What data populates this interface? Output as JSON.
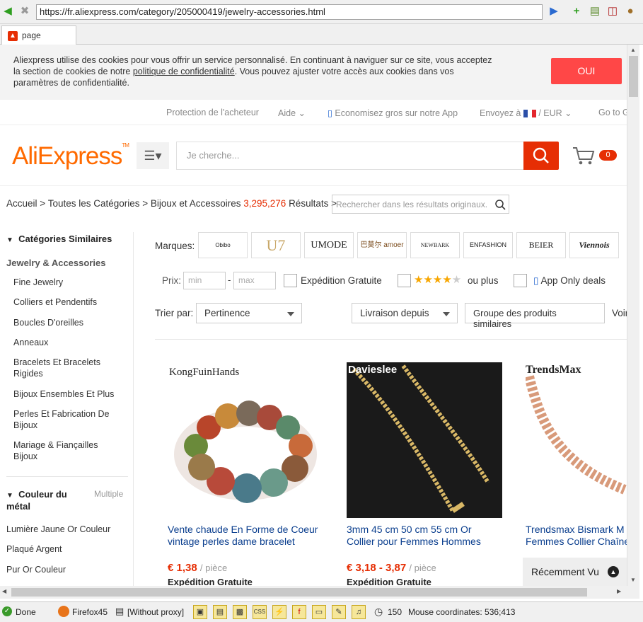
{
  "browser": {
    "url": "https://fr.aliexpress.com/category/205000419/jewelry-accessories.html",
    "tab_title": "page"
  },
  "cookie": {
    "text_1": "Aliexpress utilise des cookies pour vous offrir un service personnalisé. En continuant à naviguer sur ce site, vous acceptez la section de cookies de notre ",
    "link": "politique de confidentialité",
    "text_2": ". Vous pouvez ajuster votre accès aux cookies dans vos paramètres de confidentialité.",
    "ok": "OUI"
  },
  "topnav": {
    "protection": "Protection de l'acheteur",
    "aide": "Aide",
    "app": "Economisez gros sur notre App",
    "ship": "Envoyez à",
    "currency": "EUR",
    "goto": "Go to G"
  },
  "header": {
    "logo": "AliExpress",
    "search_placeholder": "Je cherche...",
    "cart_count": "0"
  },
  "breadcrumb": {
    "home": "Accueil",
    "all": "Toutes les Catégories",
    "current": "Bijoux et Accessoires",
    "count": "3,295,276",
    "results": "Résultats",
    "refine_placeholder": "Rechercher dans les résultats originaux."
  },
  "sidebar": {
    "similar_title": "Catégories Similaires",
    "category": "Jewelry & Accessories",
    "items": [
      "Fine Jewelry",
      "Colliers et Pendentifs",
      "Boucles D'oreilles",
      "Anneaux",
      "Bracelets Et Bracelets Rigides",
      "Bijoux Ensembles Et Plus",
      "Perles Et Fabrication De Bijoux",
      "Mariage & Fiançailles Bijoux"
    ],
    "metal_title": "Couleur du métal",
    "metal_multi": "Multiple",
    "metal_items": [
      "Lumière Jaune Or Couleur",
      "Plaqué Argent",
      "Pur Or Couleur"
    ]
  },
  "filters": {
    "brands_label": "Marques:",
    "brands": [
      "Obibo",
      "U7",
      "UMODE",
      "巴莫尔 amoer",
      "NEWBARK",
      "ENFASHION",
      "BEIER",
      "Viennois"
    ],
    "price_label": "Prix:",
    "min": "min",
    "max": "max",
    "free_shipping": "Expédition Gratuite",
    "rating_suffix": "ou plus",
    "rating": 4,
    "app_only": "App Only deals",
    "sort_label": "Trier par:",
    "sort_value": "Pertinence",
    "ship_from": "Livraison depuis",
    "group": "Groupe des produits similaires",
    "view": "Voir"
  },
  "products": [
    {
      "brand": "KongFuinHands",
      "title_1": "Vente chaude En Forme de Coeur",
      "title_2": "vintage perles dame bracelet",
      "price": "€ 1,38",
      "unit": "/ pièce",
      "shipping": "Expédition Gratuite"
    },
    {
      "brand": "Davieslee",
      "title_1": "3mm 45 cm 50 cm 55 cm Or",
      "title_2": "Collier pour Femmes Hommes",
      "price": "€ 3,18 - 3,87",
      "unit": "/ pièce",
      "shipping": "Expédition Gratuite"
    },
    {
      "brand": "TrendsMax",
      "title_1": "Trendsmax Bismark M",
      "title_2": "Femmes Collier Chaîne",
      "price": "",
      "unit": "",
      "shipping": ""
    }
  ],
  "recent": "Récemment Vu",
  "status": {
    "done": "Done",
    "browser": "Firefox45",
    "proxy": "[Without proxy]",
    "zoom": "150",
    "mouse": "Mouse coordinates: 536;413"
  }
}
